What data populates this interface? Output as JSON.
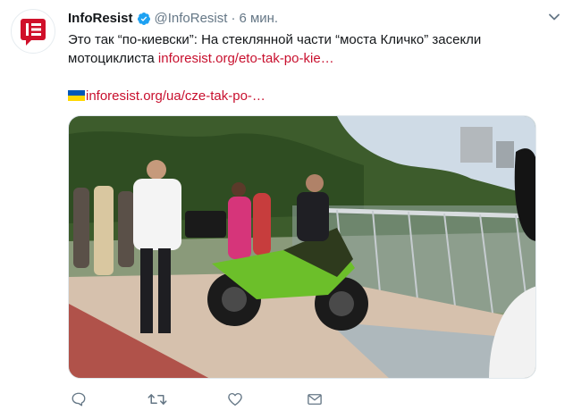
{
  "tweet": {
    "author_name": "InfoResist",
    "author_handle": "@InfoResist",
    "separator": "·",
    "time": "6 мин.",
    "text_line1": "Это так “по-киевски”: На стеклянной части “моста Кличко” засекли",
    "text_line2_prefix": "мотоциклиста ",
    "link1": "inforesist.org/eto-tak-po-kie…",
    "link2": "inforesist.org/ua/cze-tak-po-…"
  },
  "icons": {
    "avatar": "inforesist-logo-icon",
    "verified": "verified-badge-icon",
    "menu": "chevron-down-icon",
    "flag": "ukraine-flag-icon",
    "reply": "reply-icon",
    "retweet": "retweet-icon",
    "like": "heart-icon",
    "dm": "envelope-icon"
  },
  "colors": {
    "link": "#c8102e",
    "verified": "#1da1f2",
    "muted": "#657786",
    "brand": "#d0102a"
  }
}
